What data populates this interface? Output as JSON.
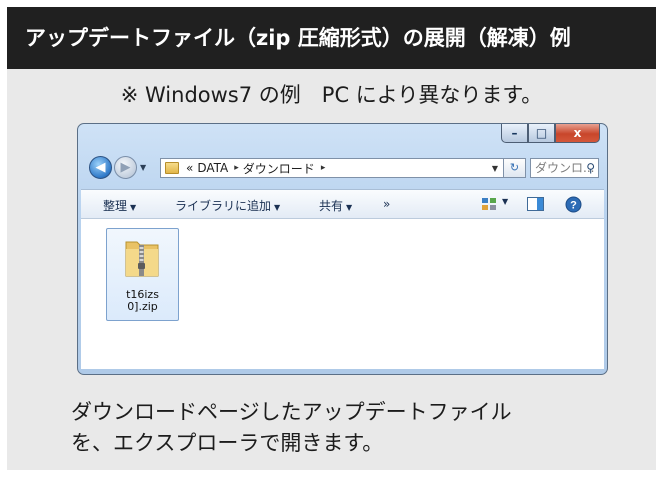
{
  "header": {
    "title": "アップデートファイル（zip 圧縮形式）の展開（解凍）例"
  },
  "note": "※ Windows7 の例　PC により異なります。",
  "explorer": {
    "window_buttons": {
      "minimize": "–",
      "maximize": "□",
      "close": "x"
    },
    "nav": {
      "back_icon": "◀",
      "forward_icon": "▶",
      "history_icon": "▼"
    },
    "address": {
      "path_prefix": "«",
      "segments": [
        "DATA",
        "ダウンロード"
      ],
      "separator": "▸",
      "dropdown_icon": "▼",
      "refresh_icon": "↻"
    },
    "search": {
      "placeholder": "ダウンロ...",
      "icon": "⚲"
    },
    "toolbar": {
      "organize": "整理",
      "add_to_library": "ライブラリに追加",
      "share": "共有",
      "more": "»",
      "dropdown_icon": "▼",
      "help_icon": "?"
    },
    "files": [
      {
        "name_line1": "t16izs",
        "name_line2": "0].zip",
        "icon": "zip-folder-icon"
      }
    ]
  },
  "description": {
    "line1": "ダウンロードページしたアップデートファイル",
    "line2": "を、エクスプローラで開きます。"
  },
  "colors": {
    "header_bg": "#202020",
    "card_bg": "#e9e9e9",
    "window_frame": "#b9d3ef",
    "close_button": "#c8462b"
  }
}
